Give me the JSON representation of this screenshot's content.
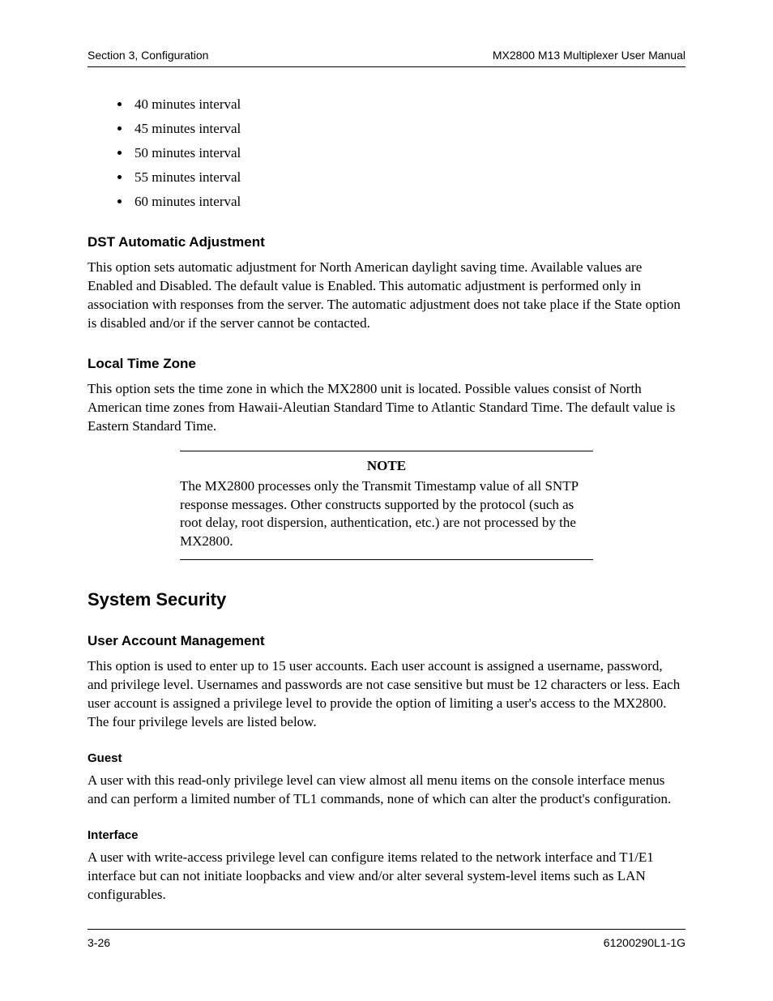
{
  "header": {
    "left": "Section 3, Configuration",
    "right": "MX2800 M13 Multiplexer User Manual"
  },
  "footer": {
    "left": "3-26",
    "right": "61200290L1-1G"
  },
  "intervals": [
    "40 minutes interval",
    "45 minutes interval",
    "50 minutes interval",
    "55 minutes interval",
    "60 minutes interval"
  ],
  "dst": {
    "heading": "DST Automatic Adjustment",
    "body": "This option sets automatic adjustment for North American daylight saving time. Available values are Enabled and Disabled. The default value is Enabled. This automatic adjustment is performed only in association with responses from the server. The automatic adjustment does not take place if the State option is disabled and/or if the server cannot be contacted."
  },
  "tz": {
    "heading": "Local Time Zone",
    "body": "This option sets the time zone in which the MX2800 unit is located. Possible values consist of North American time zones from Hawaii-Aleutian Standard Time to Atlantic Standard Time. The default value is Eastern Standard Time."
  },
  "note": {
    "title": "NOTE",
    "body": "The MX2800 processes only the Transmit Timestamp value of all SNTP response messages. Other constructs supported by the protocol (such as root delay, root dispersion, authentication, etc.) are not processed by the MX2800."
  },
  "security": {
    "heading": "System Security"
  },
  "uam": {
    "heading": "User Account Management",
    "body": "This option is used to enter up to 15 user accounts. Each user account is assigned a username, password, and privilege level. Usernames and passwords are not case sensitive but must be 12 characters or less. Each user account is assigned a privilege level to provide the option of limiting a user's access to the MX2800. The four privilege levels are listed below."
  },
  "guest": {
    "heading": "Guest",
    "body": "A user with this read-only privilege level can view almost all menu items on the console interface menus and can perform a limited number of TL1 commands, none of which can alter the product's configuration."
  },
  "iface": {
    "heading": "Interface",
    "body": "A user with write-access privilege level can configure items related to the network interface and T1/E1 interface but can not initiate loopbacks and view and/or alter several system-level items such as LAN configurables."
  }
}
